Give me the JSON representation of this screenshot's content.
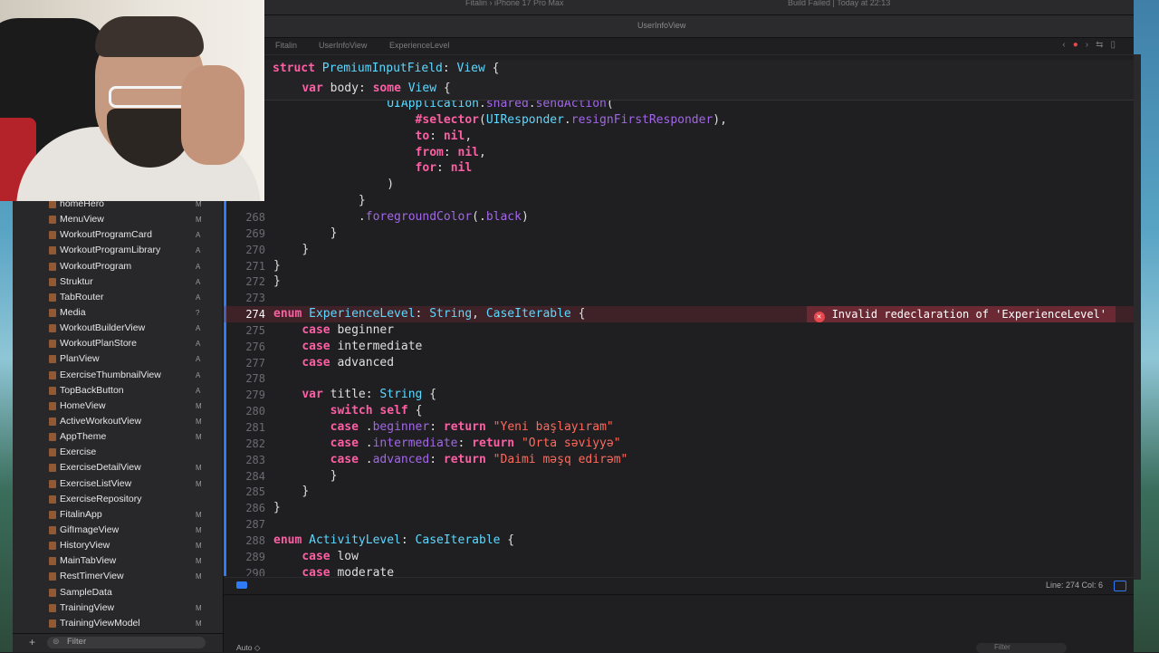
{
  "titlebar": {
    "breadcrumb": "Fitalin  ›  iPhone 17 Pro Max",
    "status": "Build Failed | Today at 22:13"
  },
  "tab": {
    "active": "UserInfoView"
  },
  "jumpbar": {
    "segments": [
      "Fitalin",
      "UserInfoView",
      "ExperienceLevel"
    ]
  },
  "navigator": {
    "items": [
      {
        "name": "homeHero",
        "badge": "M"
      },
      {
        "name": "MenuView",
        "badge": "M"
      },
      {
        "name": "WorkoutProgramCard",
        "badge": "A"
      },
      {
        "name": "WorkoutProgramLibrary",
        "badge": "A"
      },
      {
        "name": "WorkoutProgram",
        "badge": "A"
      },
      {
        "name": "Struktur",
        "badge": "A"
      },
      {
        "name": "TabRouter",
        "badge": "A"
      },
      {
        "name": "Media",
        "badge": "?"
      },
      {
        "name": "WorkoutBuilderView",
        "badge": "A"
      },
      {
        "name": "WorkoutPlanStore",
        "badge": "A"
      },
      {
        "name": "PlanView",
        "badge": "A"
      },
      {
        "name": "ExerciseThumbnailView",
        "badge": "A"
      },
      {
        "name": "TopBackButton",
        "badge": "A"
      },
      {
        "name": "HomeView",
        "badge": "M"
      },
      {
        "name": "ActiveWorkoutView",
        "badge": "M"
      },
      {
        "name": "AppTheme",
        "badge": "M"
      },
      {
        "name": "Exercise",
        "badge": ""
      },
      {
        "name": "ExerciseDetailView",
        "badge": "M"
      },
      {
        "name": "ExerciseListView",
        "badge": "M"
      },
      {
        "name": "ExerciseRepository",
        "badge": ""
      },
      {
        "name": "FitalinApp",
        "badge": "M"
      },
      {
        "name": "GifImageView",
        "badge": "M"
      },
      {
        "name": "HistoryView",
        "badge": "M"
      },
      {
        "name": "MainTabView",
        "badge": "M"
      },
      {
        "name": "RestTimerView",
        "badge": "M"
      },
      {
        "name": "SampleData",
        "badge": ""
      },
      {
        "name": "TrainingView",
        "badge": "M"
      },
      {
        "name": "TrainingViewModel",
        "badge": "M"
      }
    ],
    "filter_placeholder": "Filter"
  },
  "editor": {
    "sticky": [
      {
        "num": "",
        "code": "struct PremiumInputField: View {"
      },
      {
        "num": "",
        "code": "    var body: some View {"
      }
    ],
    "lines": [
      {
        "num": "",
        "code": "                UIApplication.shared.sendAction("
      },
      {
        "num": "",
        "code": "                    #selector(UIResponder.resignFirstResponder),"
      },
      {
        "num": "",
        "code": "                    to: nil,"
      },
      {
        "num": "",
        "code": "                    from: nil,"
      },
      {
        "num": "",
        "code": "                    for: nil"
      },
      {
        "num": "",
        "code": "                )"
      },
      {
        "num": "",
        "code": "            }"
      },
      {
        "num": "268",
        "code": "            .foregroundColor(.black)"
      },
      {
        "num": "269",
        "code": "        }"
      },
      {
        "num": "270",
        "code": "    }"
      },
      {
        "num": "271",
        "code": "}"
      },
      {
        "num": "272",
        "code": "}"
      },
      {
        "num": "273",
        "code": ""
      },
      {
        "num": "274",
        "code": "enum ExperienceLevel: String, CaseIterable {"
      },
      {
        "num": "275",
        "code": "    case beginner"
      },
      {
        "num": "276",
        "code": "    case intermediate"
      },
      {
        "num": "277",
        "code": "    case advanced"
      },
      {
        "num": "278",
        "code": ""
      },
      {
        "num": "279",
        "code": "    var title: String {"
      },
      {
        "num": "280",
        "code": "        switch self {"
      },
      {
        "num": "281",
        "code": "        case .beginner: return \"Yeni başlayıram\""
      },
      {
        "num": "282",
        "code": "        case .intermediate: return \"Orta səviyyə\""
      },
      {
        "num": "283",
        "code": "        case .advanced: return \"Daimi məşq edirəm\""
      },
      {
        "num": "284",
        "code": "        }"
      },
      {
        "num": "285",
        "code": "    }"
      },
      {
        "num": "286",
        "code": "}"
      },
      {
        "num": "287",
        "code": ""
      },
      {
        "num": "288",
        "code": "enum ActivityLevel: CaseIterable {"
      },
      {
        "num": "289",
        "code": "    case low"
      },
      {
        "num": "290",
        "code": "    case moderate"
      }
    ],
    "error_message": "Invalid redeclaration of 'ExperienceLevel'"
  },
  "status": {
    "position": "Line: 274  Col: 6"
  },
  "debug": {
    "auto_label": "Auto ◇",
    "filter_placeholder": "Filter"
  },
  "colors": {
    "keyword": "#fc5fa3",
    "type": "#5dd8ff",
    "function": "#a167e6",
    "string": "#fc6a5d",
    "error": "#e5484d",
    "accent": "#2f7bf6"
  }
}
